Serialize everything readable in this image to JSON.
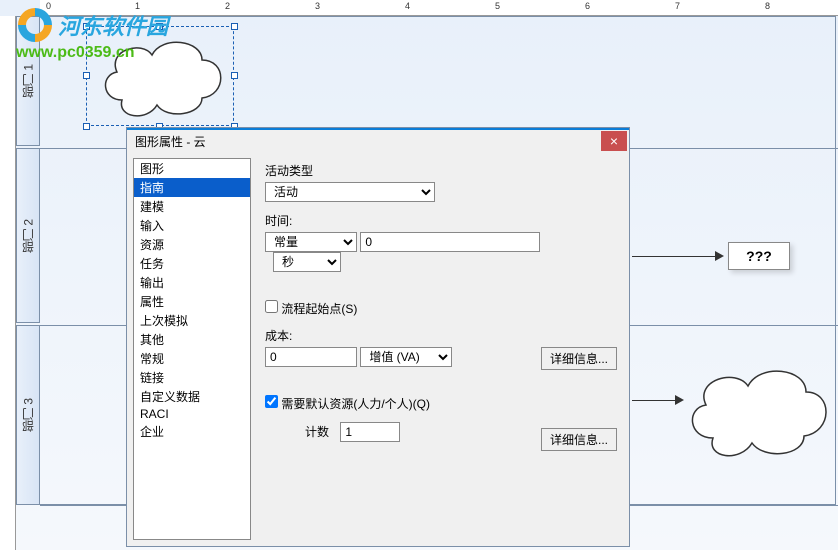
{
  "watermark": {
    "text_cn": "河东软件园",
    "url": "www.pc0359.cn"
  },
  "lanes": [
    "部门 1",
    "部门 2",
    "部门 3"
  ],
  "question_label": "???",
  "dialog": {
    "title": "图形属性 - 云",
    "close": "×",
    "sidebar_items": [
      "图形",
      "指南",
      "建模",
      "输入",
      "资源",
      "任务",
      "输出",
      "属性",
      "上次模拟",
      "其他",
      "常规",
      "链接",
      "自定义数据",
      "RACI",
      "企业"
    ],
    "selected_index": 1,
    "form": {
      "activity_type_label": "活动类型",
      "activity_type_value": "活动",
      "time_label": "时间:",
      "time_type_value": "常量",
      "time_value": "0",
      "time_unit_value": "秒",
      "start_point_label": "流程起始点(S)",
      "start_point_checked": false,
      "cost_label": "成本:",
      "cost_value": "0",
      "cost_type_value": "增值 (VA)",
      "detail_btn": "详细信息...",
      "default_resource_label": "需要默认资源(人力/个人)(Q)",
      "default_resource_checked": true,
      "count_label": "计数",
      "count_value": "1",
      "detail_btn2": "详细信息..."
    }
  }
}
